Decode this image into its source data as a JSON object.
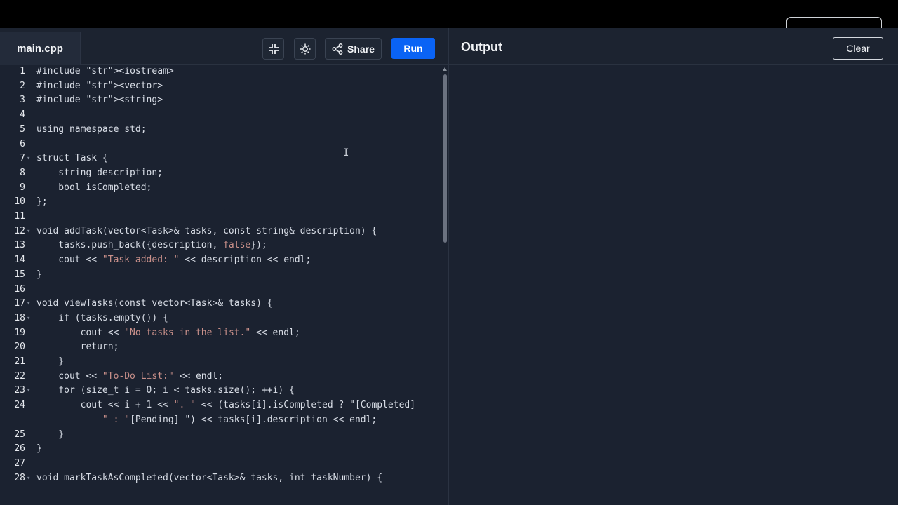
{
  "editor": {
    "filename": "main.cpp",
    "share_label": "Share",
    "run_label": "Run",
    "icons": [
      "collapse-icon",
      "theme-sun-icon",
      "share-icon"
    ]
  },
  "output": {
    "title": "Output",
    "clear_label": "Clear"
  },
  "colors": {
    "run_button": "#0a63f5",
    "background": "#1b2230",
    "string_literal": "#c9908a"
  },
  "code_lines": [
    {
      "n": "1",
      "text": "#include <iostream>"
    },
    {
      "n": "2",
      "text": "#include <vector>"
    },
    {
      "n": "3",
      "text": "#include <string>"
    },
    {
      "n": "4",
      "text": ""
    },
    {
      "n": "5",
      "text": "using namespace std;"
    },
    {
      "n": "6",
      "text": ""
    },
    {
      "n": "7",
      "text": "struct Task {"
    },
    {
      "n": "8",
      "text": "    string description;"
    },
    {
      "n": "9",
      "text": "    bool isCompleted;"
    },
    {
      "n": "10",
      "text": "};"
    },
    {
      "n": "11",
      "text": ""
    },
    {
      "n": "12",
      "text": "void addTask(vector<Task>& tasks, const string& description) {"
    },
    {
      "n": "13",
      "text": "    tasks.push_back({description, false});"
    },
    {
      "n": "14",
      "text": "    cout << \"Task added: \" << description << endl;"
    },
    {
      "n": "15",
      "text": "}"
    },
    {
      "n": "16",
      "text": ""
    },
    {
      "n": "17",
      "text": "void viewTasks(const vector<Task>& tasks) {"
    },
    {
      "n": "18",
      "text": "    if (tasks.empty()) {"
    },
    {
      "n": "19",
      "text": "        cout << \"No tasks in the list.\" << endl;"
    },
    {
      "n": "20",
      "text": "        return;"
    },
    {
      "n": "21",
      "text": "    }"
    },
    {
      "n": "22",
      "text": "    cout << \"To-Do List:\" << endl;"
    },
    {
      "n": "23",
      "text": "    for (size_t i = 0; i < tasks.size(); ++i) {"
    },
    {
      "n": "24",
      "text": "        cout << i + 1 << \". \" << (tasks[i].isCompleted ? \"[Completed]"
    },
    {
      "n": "",
      "text": "            \" : \"[Pending] \") << tasks[i].description << endl;"
    },
    {
      "n": "25",
      "text": "    }"
    },
    {
      "n": "26",
      "text": "}"
    },
    {
      "n": "27",
      "text": ""
    },
    {
      "n": "28",
      "text": "void markTaskAsCompleted(vector<Task>& tasks, int taskNumber) {"
    }
  ],
  "fold_lines": [
    "7",
    "12",
    "17",
    "18",
    "23",
    "28"
  ]
}
